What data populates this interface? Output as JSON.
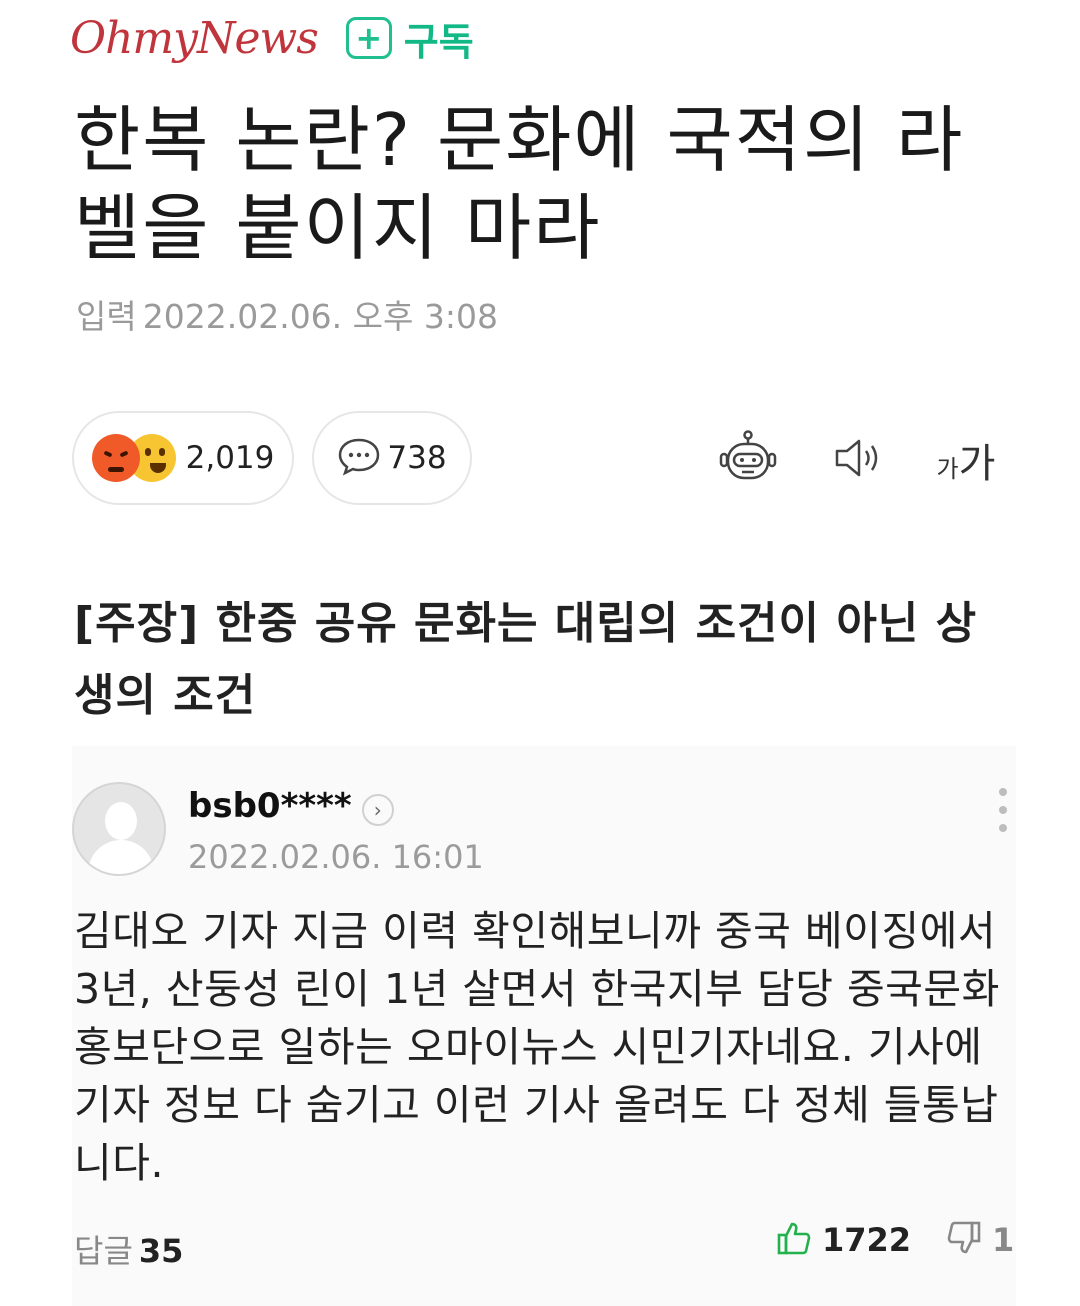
{
  "header": {
    "logo_text": "OhmyNews",
    "subscribe_label": "구독",
    "logo_color": "#c0343c",
    "subscribe_color": "#12b886"
  },
  "article": {
    "title": "한복 논란? 문화에 국적의 라벨을 붙이지 마라",
    "date_label": "입력",
    "date_value": "2022.02.06. 오후 3:08",
    "subtitle": "[주장] 한중 공유 문화는 대립의 조건이 아닌 상생의 조건"
  },
  "reactions": {
    "reaction_count": "2,019",
    "comment_count": "738",
    "icons": [
      "angry-emoji-icon",
      "laugh-emoji-icon",
      "speech-bubble-icon",
      "robot-icon",
      "speaker-icon",
      "font-size-icon"
    ]
  },
  "tools": {
    "font_size_small": "가",
    "font_size_large": "가"
  },
  "comment": {
    "username": "bsb0****",
    "time": "2022.02.06. 16:01",
    "body": "김대오 기자 지금 이력 확인해보니까 중국 베이징에서 3년, 산둥성 린이 1년 살면서 한국지부 담당 중국문화홍보단으로 일하는 오마이뉴스 시민기자네요. 기사에 기자 정보 다 숨기고 이런 기사 올려도 다 정체 들통납니다.",
    "reply_label": "답글",
    "reply_count": "35",
    "like_count": "1722",
    "dislike_count": "1",
    "like_color": "#22b14c"
  }
}
